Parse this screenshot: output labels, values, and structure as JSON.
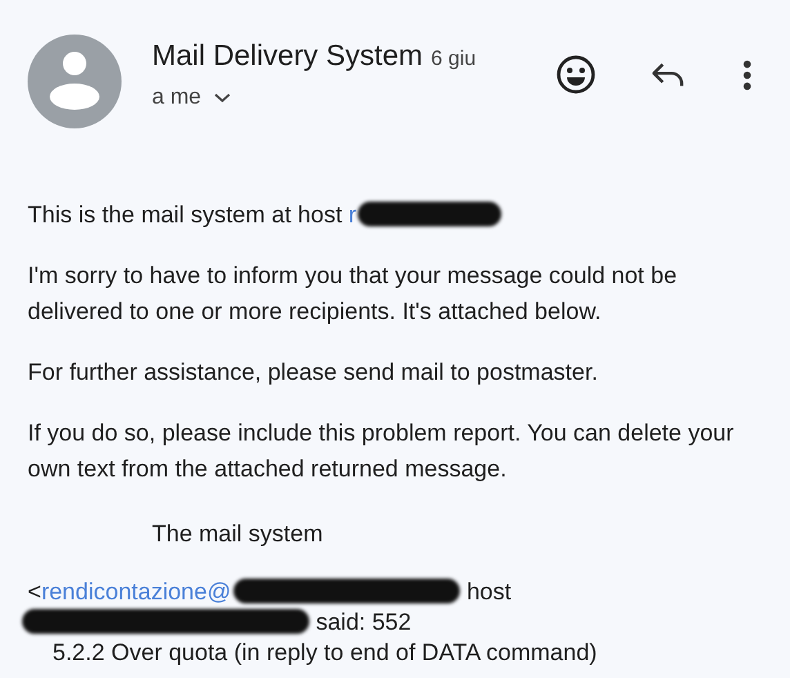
{
  "header": {
    "sender": "Mail Delivery System",
    "date": "6 giu",
    "recipient": "a me"
  },
  "body": [
    {
      "kind": "para",
      "segments": [
        {
          "kind": "text",
          "text": "This is the mail system at host "
        },
        {
          "kind": "link",
          "text": "r"
        },
        {
          "kind": "redaction"
        }
      ]
    },
    {
      "kind": "para",
      "segments": [
        {
          "kind": "text",
          "text": "I'm sorry to have to inform you that your message could not be delivered to one or more recipients. It's attached below."
        }
      ]
    },
    {
      "kind": "para",
      "segments": [
        {
          "kind": "text",
          "text": "For further assistance, please send mail to postmaster."
        }
      ]
    },
    {
      "kind": "para",
      "segments": [
        {
          "kind": "text",
          "text": "If you do so, please include this problem report. You can delete your own text from the attached returned message."
        }
      ]
    },
    {
      "kind": "signature",
      "segments": [
        {
          "kind": "text",
          "text": "The mail system"
        }
      ]
    },
    {
      "kind": "line",
      "segments": [
        {
          "kind": "text",
          "text": "<"
        },
        {
          "kind": "link",
          "text": "rendicontazione@"
        },
        {
          "kind": "redaction"
        },
        {
          "kind": "text",
          "text": " host"
        }
      ]
    },
    {
      "kind": "line",
      "segments": [
        {
          "kind": "redaction"
        },
        {
          "kind": "text",
          "text": " said: 552"
        }
      ]
    },
    {
      "kind": "indented",
      "segments": [
        {
          "kind": "text",
          "text": "5.2.2 Over quota (in reply to end of DATA command)"
        }
      ]
    }
  ]
}
